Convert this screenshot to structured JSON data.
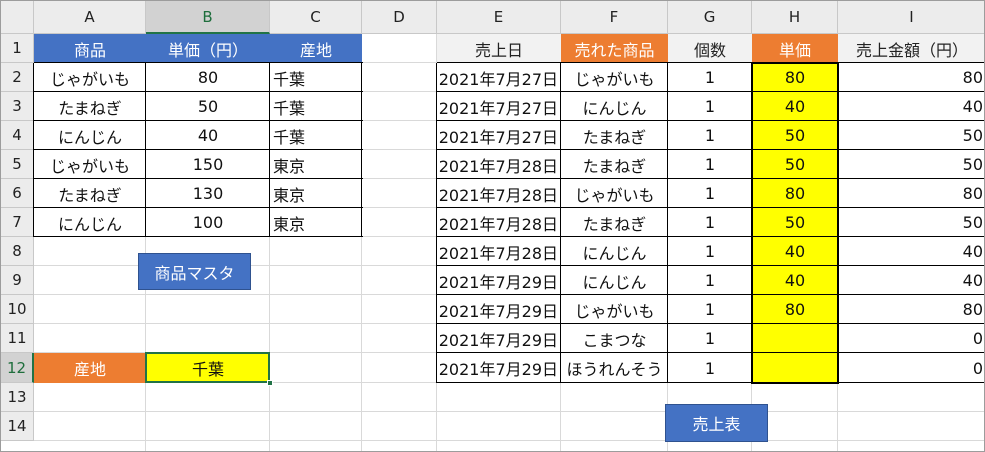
{
  "columns": [
    "A",
    "B",
    "C",
    "D",
    "E",
    "F",
    "G",
    "H",
    "I"
  ],
  "rows": [
    "1",
    "2",
    "3",
    "4",
    "5",
    "6",
    "7",
    "8",
    "9",
    "10",
    "11",
    "12",
    "13",
    "14"
  ],
  "selected_column": "B",
  "selected_row": "12",
  "master": {
    "headers": [
      "商品",
      "単価（円）",
      "産地"
    ],
    "rows": [
      [
        "じゃがいも",
        "80",
        "千葉"
      ],
      [
        "たまねぎ",
        "50",
        "千葉"
      ],
      [
        "にんじん",
        "40",
        "千葉"
      ],
      [
        "じゃがいも",
        "150",
        "東京"
      ],
      [
        "たまねぎ",
        "130",
        "東京"
      ],
      [
        "にんじん",
        "100",
        "東京"
      ]
    ]
  },
  "master_label": "商品マスタ",
  "filter": {
    "label": "産地",
    "value": "千葉"
  },
  "sales": {
    "headers": [
      "売上日",
      "売れた商品",
      "個数",
      "単価",
      "売上金額（円）"
    ],
    "rows": [
      [
        "2021年7月27日",
        "じゃがいも",
        "1",
        "80",
        "80"
      ],
      [
        "2021年7月27日",
        "にんじん",
        "1",
        "40",
        "40"
      ],
      [
        "2021年7月27日",
        "たまねぎ",
        "1",
        "50",
        "50"
      ],
      [
        "2021年7月28日",
        "たまねぎ",
        "1",
        "50",
        "50"
      ],
      [
        "2021年7月28日",
        "じゃがいも",
        "1",
        "80",
        "80"
      ],
      [
        "2021年7月28日",
        "たまねぎ",
        "1",
        "50",
        "50"
      ],
      [
        "2021年7月28日",
        "にんじん",
        "1",
        "40",
        "40"
      ],
      [
        "2021年7月29日",
        "にんじん",
        "1",
        "40",
        "40"
      ],
      [
        "2021年7月29日",
        "じゃがいも",
        "1",
        "80",
        "80"
      ],
      [
        "2021年7月29日",
        "こまつな",
        "1",
        "",
        "0"
      ],
      [
        "2021年7月29日",
        "ほうれんそう",
        "1",
        "",
        "0"
      ]
    ]
  },
  "sales_label": "売上表",
  "colors": {
    "header_blue": "#4472c4",
    "header_orange": "#ed7d31",
    "highlight_yellow": "#ffff00",
    "selection_green": "#217346"
  }
}
